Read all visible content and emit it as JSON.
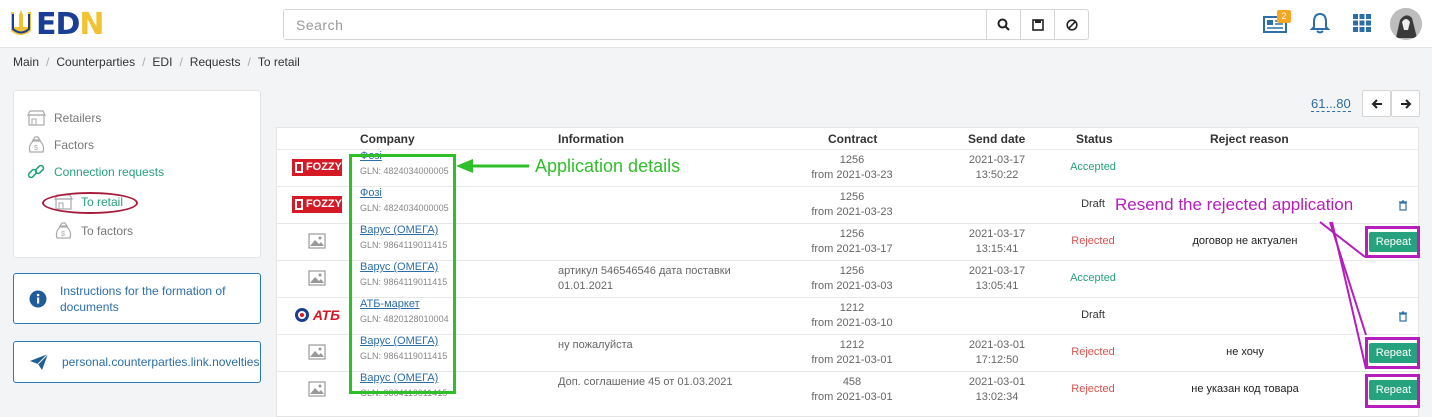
{
  "header": {
    "logo_left": "ED",
    "logo_right": "N",
    "search_placeholder": "Search",
    "notifications_badge": "2"
  },
  "breadcrumb": [
    "Main",
    "Counterparties",
    "EDI",
    "Requests",
    "To retail"
  ],
  "sidebar": {
    "items": [
      {
        "label": "Retailers",
        "icon": "store-icon"
      },
      {
        "label": "Factors",
        "icon": "money-bag-icon"
      },
      {
        "label": "Connection requests",
        "icon": "link-icon"
      },
      {
        "label": "To retail",
        "icon": "store-icon"
      },
      {
        "label": "To factors",
        "icon": "money-bag-icon"
      }
    ]
  },
  "cards": {
    "instructions": "Instructions for the formation of documents",
    "novelties": "personal.counterparties.link.novelties"
  },
  "pager": {
    "range": "61...80"
  },
  "table": {
    "headers": {
      "company": "Company",
      "information": "Information",
      "contract": "Contract",
      "send_date": "Send date",
      "status": "Status",
      "reject_reason": "Reject reason"
    },
    "rows": [
      {
        "logo": "fozzy",
        "company": "Фозі",
        "gln": "GLN: 4824034000005",
        "info1": "",
        "info2": "",
        "contract": "1256",
        "contract_from": "from 2021-03-23",
        "date": "2021-03-17",
        "time": "13:50:22",
        "status": "Accepted",
        "reason": "",
        "action": ""
      },
      {
        "logo": "fozzy",
        "company": "Фозі",
        "gln": "GLN: 4824034000005",
        "info1": "",
        "info2": "",
        "contract": "1256",
        "contract_from": "from 2021-03-23",
        "date": "",
        "time": "",
        "status": "Draft",
        "reason": "",
        "action": "trash"
      },
      {
        "logo": "image",
        "company": "Варус (ОМЕГА)",
        "gln": "GLN: 9864119011415",
        "info1": "",
        "info2": "",
        "contract": "1256",
        "contract_from": "from 2021-03-17",
        "date": "2021-03-17",
        "time": "13:15:41",
        "status": "Rejected",
        "reason": "договор не актуален",
        "action": "Repeat"
      },
      {
        "logo": "image",
        "company": "Варус (ОМЕГА)",
        "gln": "GLN: 9864119011415",
        "info1": "артикул 546546546 дата поставки",
        "info2": "01.01.2021",
        "contract": "1256",
        "contract_from": "from 2021-03-03",
        "date": "2021-03-17",
        "time": "13:05:41",
        "status": "Accepted",
        "reason": "",
        "action": ""
      },
      {
        "logo": "atb",
        "company": "АТБ-маркет",
        "gln": "GLN: 4820128010004",
        "info1": "",
        "info2": "",
        "contract": "1212",
        "contract_from": "from 2021-03-10",
        "date": "",
        "time": "",
        "status": "Draft",
        "reason": "",
        "action": "trash"
      },
      {
        "logo": "image",
        "company": "Варус (ОМЕГА)",
        "gln": "GLN: 9864119011415",
        "info1": "ну пожалуйста",
        "info2": "",
        "contract": "1212",
        "contract_from": "from 2021-03-01",
        "date": "2021-03-01",
        "time": "17:12:50",
        "status": "Rejected",
        "reason": "не хочу",
        "action": "Repeat"
      },
      {
        "logo": "image",
        "company": "Варус (ОМЕГА)",
        "gln": "GLN: 9864119011415",
        "info1": "Доп. соглашение 45 от 01.03.2021",
        "info2": "",
        "contract": "458",
        "contract_from": "from 2021-03-01",
        "date": "2021-03-01",
        "time": "13:02:34",
        "status": "Rejected",
        "reason": "не указан код товара",
        "action": "Repeat"
      }
    ]
  },
  "annotations": {
    "details": "Application details",
    "resend": "Resend the rejected application"
  },
  "logo_texts": {
    "fozzy": "FOZZY",
    "atb": "АТБ"
  },
  "colors": {
    "accent_green": "#26a37e",
    "link_blue": "#2d6ea8",
    "rejected_red": "#d9534f",
    "annotation_green": "#2fbf29",
    "annotation_purple": "#b51dbd"
  }
}
